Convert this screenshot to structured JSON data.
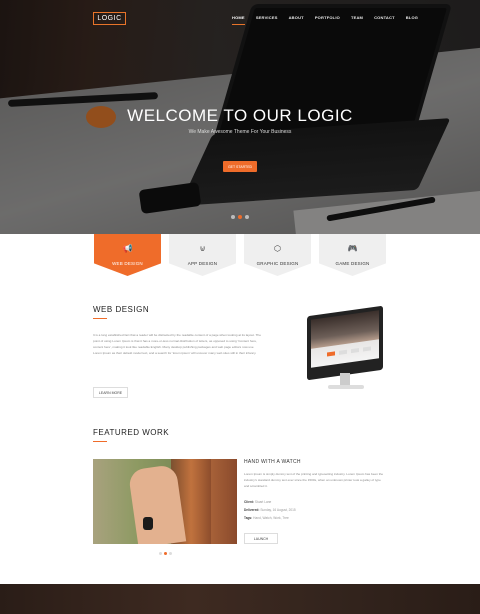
{
  "nav": {
    "logo": "LOGIC",
    "items": [
      "HOME",
      "SERVICES",
      "ABOUT",
      "PORTFOLIO",
      "TEAM",
      "CONTACT",
      "BLOG"
    ]
  },
  "hero": {
    "title": "WELCOME TO OUR LOGIC",
    "subtitle": "We Make Awesome Theme For Your Business",
    "button": "GET STARTED"
  },
  "services": [
    {
      "icon": "megaphone-icon",
      "glyph": "📢",
      "label": "WEB DESIGN"
    },
    {
      "icon": "magnet-icon",
      "glyph": "⊍",
      "label": "APP DESIGN"
    },
    {
      "icon": "cube-icon",
      "glyph": "⬡",
      "label": "GRAPHIC DESIGN"
    },
    {
      "icon": "gamepad-icon",
      "glyph": "🎮",
      "label": "GAME DESIGN"
    }
  ],
  "web_design": {
    "heading": "WEB DESIGN",
    "body": "It is a long established fact that a reader will be distracted by the readable content of a page when looking at its layout. The point of using Lorem Ipsum is that it has a more-or-less normal distribution of letters, as opposed to using 'Content here, content here', making it look like readable English. Many desktop publishing packages and web page editors now use Lorem Ipsum as their default model text, and a search for 'lorem ipsum' will uncover many web sites still in their infancy.",
    "button": "LEARN MORE"
  },
  "featured": {
    "heading": "FEATURED WORK",
    "item_title": "HAND WITH A WATCH",
    "item_body": "Lorem Ipsum is simply dummy text of the printing and typesetting industry. Lorem Ipsum has been the industry's standard dummy text ever since the 1500s, when an unknown printer took a galley of type and scrambled it.",
    "client_label": "Client:",
    "client_value": "Stuart Lane",
    "delivered_label": "Delivered:",
    "delivered_value": "Sunday, 16 August, 2015",
    "tags_label": "Tags:",
    "tags_value": "Hand, Watch, Work, Tree",
    "button": "LAUNCH"
  }
}
